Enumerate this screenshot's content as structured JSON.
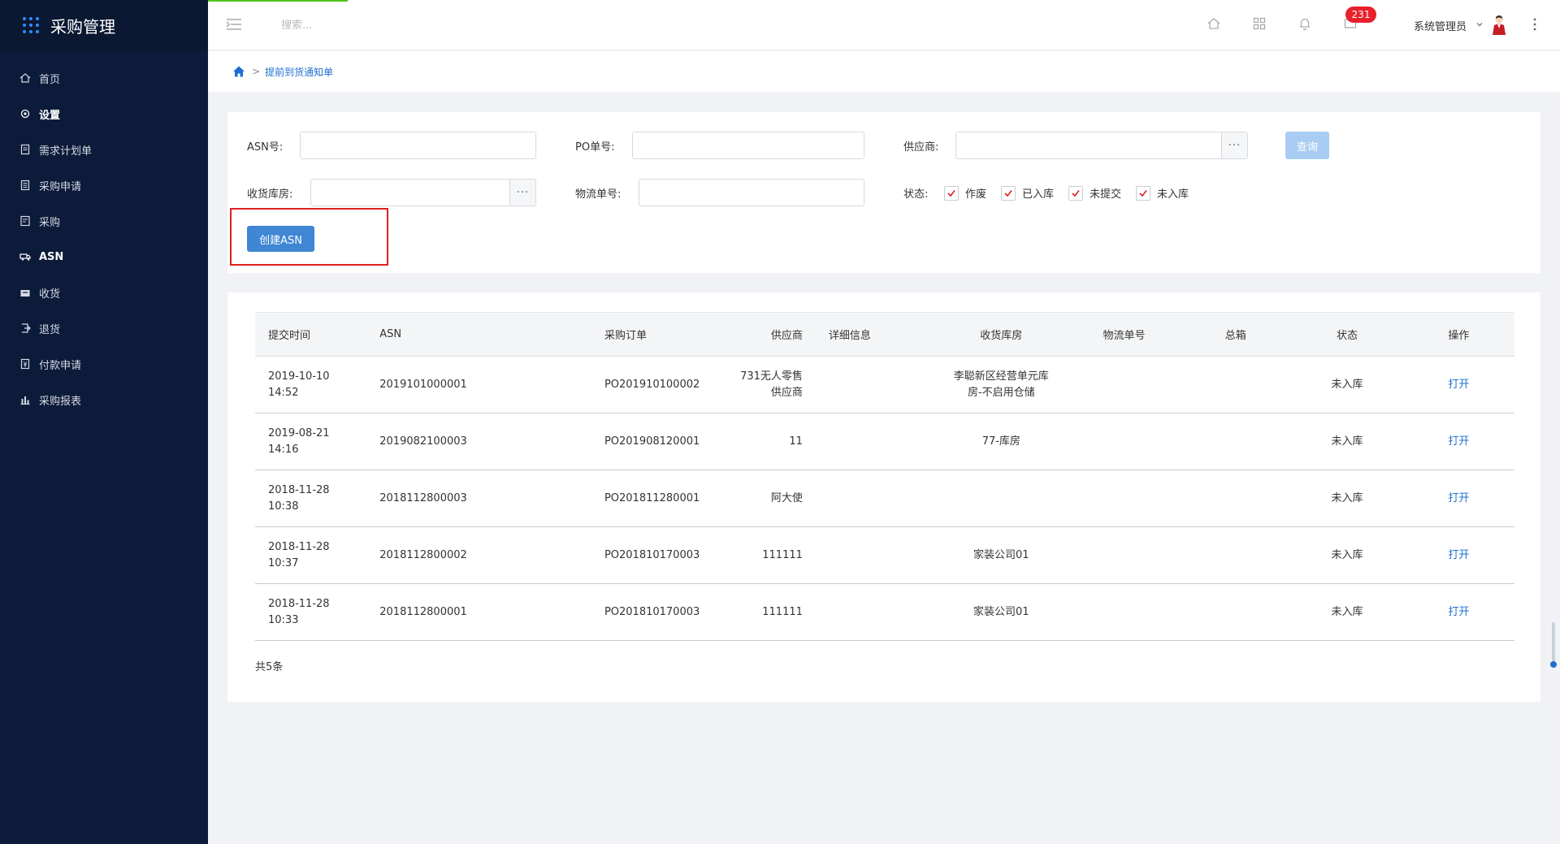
{
  "sidebar": {
    "title": "采购管理",
    "items": [
      {
        "label": "首页",
        "icon": "home-icon"
      },
      {
        "label": "设置",
        "icon": "gear-icon"
      },
      {
        "label": "需求计划单",
        "icon": "document-icon"
      },
      {
        "label": "采购申请",
        "icon": "list-icon"
      },
      {
        "label": "采购",
        "icon": "form-icon"
      },
      {
        "label": "ASN",
        "icon": "truck-icon"
      },
      {
        "label": "收货",
        "icon": "inbox-icon"
      },
      {
        "label": "退货",
        "icon": "return-icon"
      },
      {
        "label": "付款申请",
        "icon": "payment-icon"
      },
      {
        "label": "采购报表",
        "icon": "bar-chart-icon"
      }
    ]
  },
  "topbar": {
    "search_placeholder": "搜索...",
    "badge_count": "231",
    "user_name": "系统管理员"
  },
  "breadcrumb": {
    "current": "提前到货通知单"
  },
  "filter": {
    "asn_label": "ASN号:",
    "po_label": "PO单号:",
    "supplier_label": "供应商:",
    "warehouse_label": "收货库房:",
    "logistics_label": "物流单号:",
    "status_label": "状态:",
    "query_button": "查询",
    "status_options": [
      {
        "label": "作废",
        "checked": true
      },
      {
        "label": "已入库",
        "checked": true
      },
      {
        "label": "未提交",
        "checked": true
      },
      {
        "label": "未入库",
        "checked": true
      }
    ],
    "create_button": "创建ASN"
  },
  "table": {
    "headers": [
      "提交时间",
      "ASN",
      "采购订单",
      "供应商",
      "详细信息",
      "收货库房",
      "物流单号",
      "总箱",
      "状态",
      "操作"
    ],
    "rows": [
      {
        "time": "2019-10-10 14:52",
        "asn": "2019101000001",
        "po": "PO201910100002",
        "supplier": "731无人零售供应商",
        "detail": "",
        "warehouse": "李聪新区经营单元库房-不启用仓储",
        "logistics": "",
        "boxes": "",
        "status": "未入库",
        "action": "打开"
      },
      {
        "time": "2019-08-21 14:16",
        "asn": "2019082100003",
        "po": "PO201908120001",
        "supplier": "11",
        "detail": "",
        "warehouse": "77-库房",
        "logistics": "",
        "boxes": "",
        "status": "未入库",
        "action": "打开"
      },
      {
        "time": "2018-11-28 10:38",
        "asn": "2018112800003",
        "po": "PO201811280001",
        "supplier": "阿大使",
        "detail": "",
        "warehouse": "",
        "logistics": "",
        "boxes": "",
        "status": "未入库",
        "action": "打开"
      },
      {
        "time": "2018-11-28 10:37",
        "asn": "2018112800002",
        "po": "PO201810170003",
        "supplier": "111111",
        "detail": "",
        "warehouse": "家装公司01",
        "logistics": "",
        "boxes": "",
        "status": "未入库",
        "action": "打开"
      },
      {
        "time": "2018-11-28 10:33",
        "asn": "2018112800001",
        "po": "PO201810170003",
        "supplier": "111111",
        "detail": "",
        "warehouse": "家装公司01",
        "logistics": "",
        "boxes": "",
        "status": "未入库",
        "action": "打开"
      }
    ],
    "total": "共5条"
  },
  "colors": {
    "sidebar_bg": "#0d1b3a",
    "accent": "#1e6fd1",
    "button": "#3f86d4",
    "badge": "#e8202b",
    "highlight": "#e02020"
  }
}
